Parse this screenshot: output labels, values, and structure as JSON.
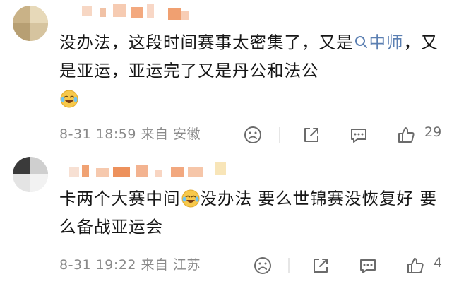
{
  "comments": [
    {
      "text_before": "没办法，这段时间赛事太密集了，又是",
      "topic": "中师",
      "text_after": "，又是亚运，亚运完了又是丹公和法公",
      "time": "8-31 18:59",
      "location": "来自 安徽",
      "like_count": "29"
    },
    {
      "text_before": "卡两个大赛中间",
      "text_after": "没办法 要么世锦赛没恢复好 要么备战亚运会",
      "time": "8-31 19:22",
      "location": "来自 江苏",
      "like_count": "4"
    }
  ],
  "icons": {
    "search": "search-icon",
    "emoji": "laughing-crying-emoji-icon",
    "dislike": "frown-face-icon",
    "share": "share-icon",
    "reply": "comment-bubble-icon",
    "like": "thumbs-up-icon"
  },
  "colors": {
    "topic": "#5b7fb2",
    "meta": "#8a8a8a",
    "icon": "#6b6b6b"
  }
}
